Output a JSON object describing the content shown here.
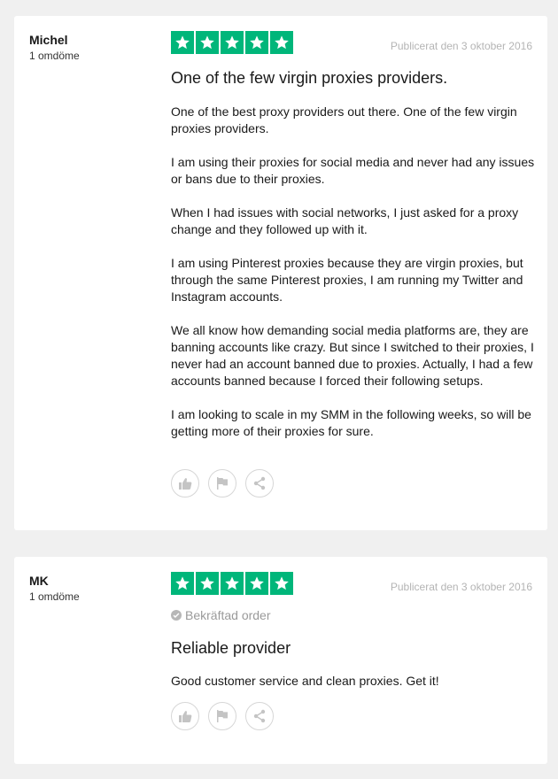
{
  "reviews": [
    {
      "author_name": "Michel",
      "author_review_count": "1 omdöme",
      "rating": 5,
      "date": "Publicerat den 3 oktober 2016",
      "title": "One of the few virgin proxies providers.",
      "paragraphs": [
        "One of the best proxy providers out there. One of the few virgin proxies providers.",
        "I am using their proxies for social media and never had any issues or bans due to their proxies.",
        "When I had issues with social networks, I just asked for a proxy change and they followed up with it.",
        "I am using Pinterest proxies because they are virgin proxies, but through the same Pinterest proxies, I am running my Twitter and Instagram accounts.",
        "We all know how demanding social media platforms are, they are banning accounts like crazy. But since I switched to their proxies, I never had an account banned due to proxies. Actually, I had a few accounts banned because I forced their following setups.",
        "I am looking to scale in my SMM in the following weeks, so will be getting more of their proxies for sure."
      ]
    },
    {
      "author_name": "MK",
      "author_review_count": "1 omdöme",
      "rating": 5,
      "date": "Publicerat den 3 oktober 2016",
      "verified_label": "Bekräftad order",
      "title": "Reliable provider",
      "paragraphs": [
        "Good customer service and clean proxies. Get it!"
      ]
    }
  ],
  "colors": {
    "star_green": "#00b67a",
    "page_background": "#f0f0f0",
    "muted_text": "#b4b4b4"
  },
  "icons": {
    "star": "star-icon",
    "useful": "thumbs-up-icon",
    "report": "flag-icon",
    "share": "share-icon",
    "verified": "check-circle-icon"
  }
}
